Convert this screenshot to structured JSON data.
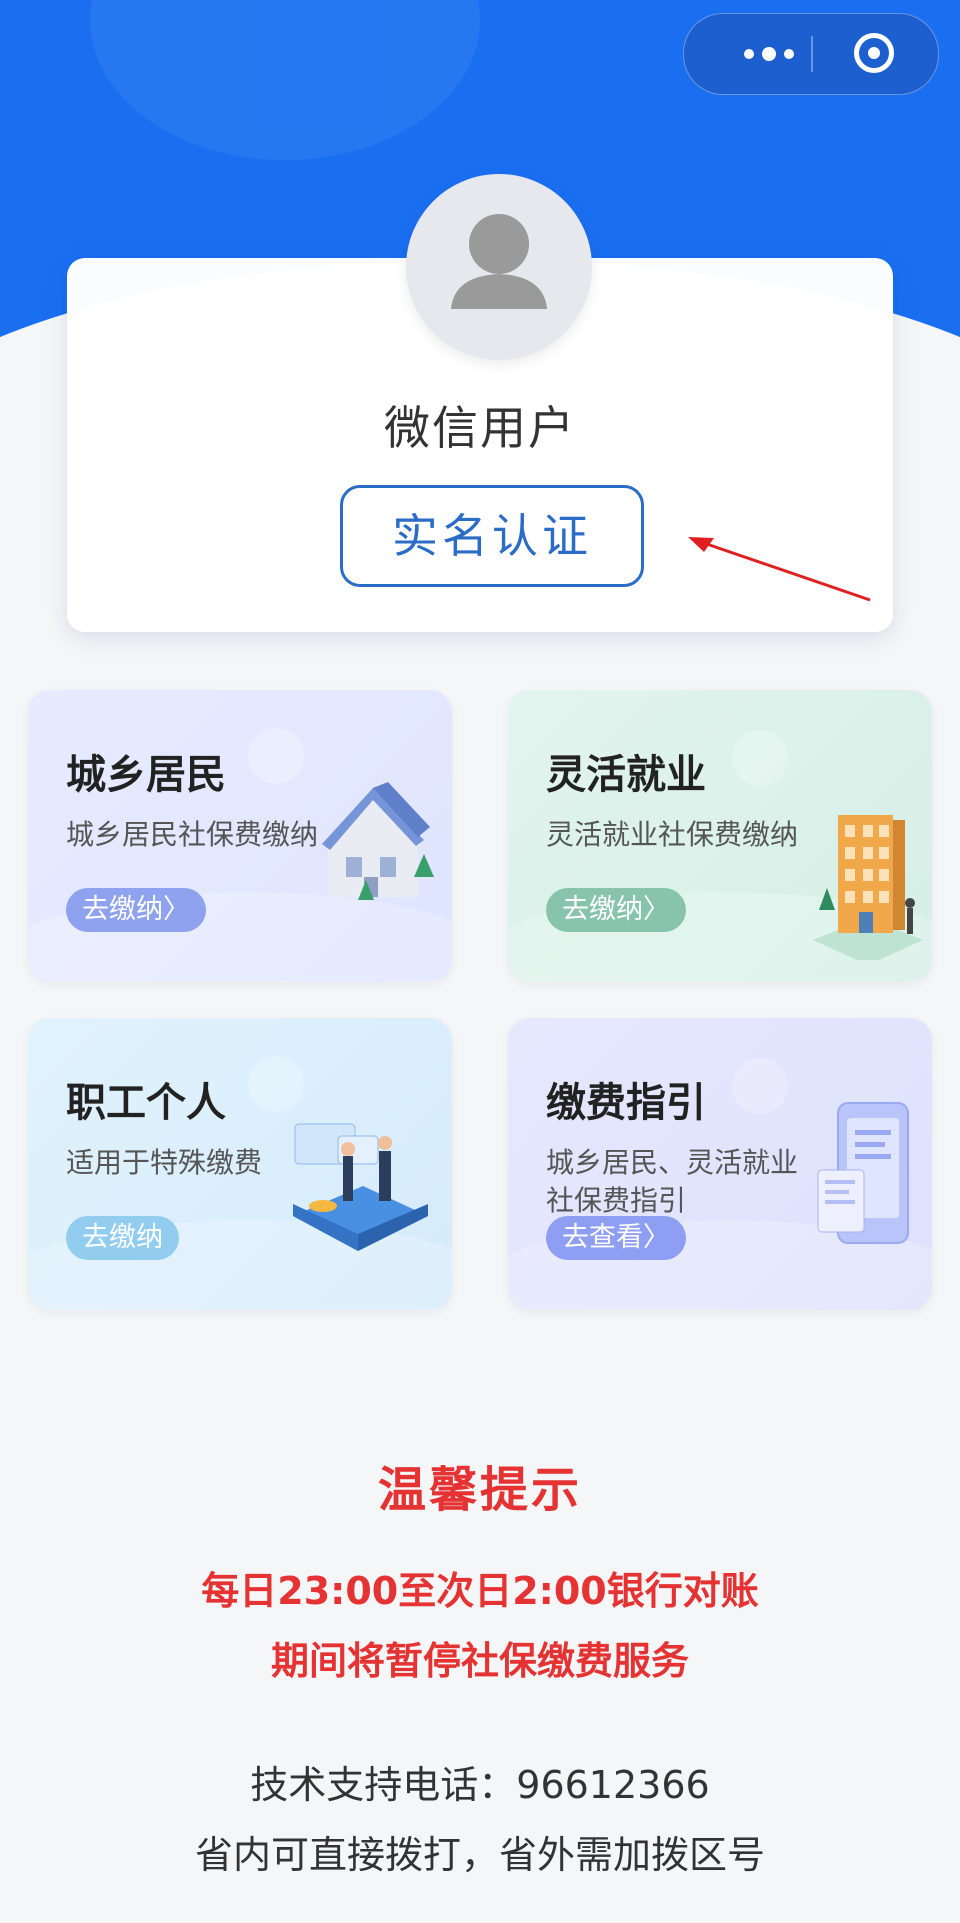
{
  "profile": {
    "user_name": "微信用户",
    "verify_button": "实名认证"
  },
  "tiles": [
    {
      "title": "城乡居民",
      "subtitle": "城乡居民社保费缴纳",
      "button": "去缴纳〉"
    },
    {
      "title": "灵活就业",
      "subtitle": "灵活就业社保费缴纳",
      "button": "去缴纳〉"
    },
    {
      "title": "职工个人",
      "subtitle": "适用于特殊缴费",
      "button": "去缴纳"
    },
    {
      "title": "缴费指引",
      "subtitle_line1": "城乡居民、灵活就业",
      "subtitle_line2": "社保费指引",
      "button": "去查看〉"
    }
  ],
  "notice": {
    "title": "温馨提示",
    "line1": "每日23:00至次日2:00银行对账",
    "line2": "期间将暂停社保缴费服务"
  },
  "support": {
    "phone_line": "技术支持电话：96612366",
    "note": "省内可直接拨打，省外需加拨区号"
  },
  "colors": {
    "brand_blue": "#1a6ff1",
    "verify_blue": "#2a6cc6",
    "notice_red": "#e53333"
  },
  "icons": [
    "more-dots-icon",
    "close-target-icon",
    "avatar-icon",
    "red-arrow-icon"
  ]
}
